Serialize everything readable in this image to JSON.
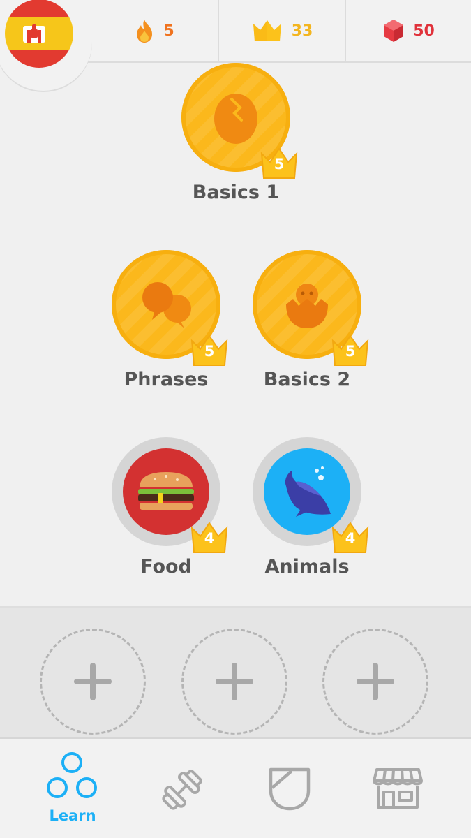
{
  "header": {
    "language_flag": "spain-flag",
    "streak": {
      "value": "5",
      "icon": "flame-icon",
      "color": "#f0731f"
    },
    "crowns": {
      "value": "33",
      "icon": "crown-icon",
      "color": "#f3b51f"
    },
    "gems": {
      "value": "50",
      "icon": "gem-icon",
      "color": "#e0323b"
    }
  },
  "skills": [
    {
      "label": "Basics 1",
      "level": "5",
      "icon": "egg-icon",
      "style": "gold"
    },
    {
      "label": "Phrases",
      "level": "5",
      "icon": "speech-bubbles-icon",
      "style": "gold"
    },
    {
      "label": "Basics 2",
      "level": "5",
      "icon": "chick-icon",
      "style": "gold"
    },
    {
      "label": "Food",
      "level": "4",
      "icon": "burger-icon",
      "style": "red",
      "color": "#d33131"
    },
    {
      "label": "Animals",
      "level": "4",
      "icon": "whale-icon",
      "style": "blue",
      "color": "#1cb0f6"
    }
  ],
  "add_slots": [
    "add-skill-slot",
    "add-skill-slot",
    "add-skill-slot"
  ],
  "nav": {
    "learn_label": "Learn",
    "active_color": "#1cb0f6",
    "items": [
      "learn-icon",
      "practice-dumbbell-icon",
      "league-shield-icon",
      "shop-icon"
    ]
  }
}
